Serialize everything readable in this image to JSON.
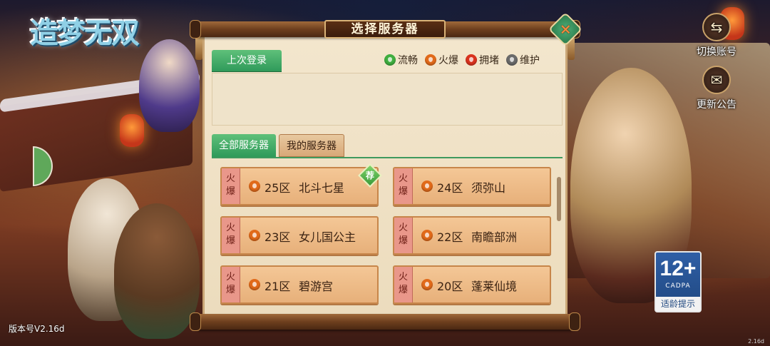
{
  "game": {
    "logo_text": "造梦无双"
  },
  "side_buttons": {
    "switch_account": "切换账号",
    "notice": "更新公告"
  },
  "dialog": {
    "title": "选择服务器",
    "last_login_tab": "上次登录",
    "legend": [
      {
        "label": "流畅",
        "color": "#3fae3f"
      },
      {
        "label": "火爆",
        "color": "#e16a1a"
      },
      {
        "label": "拥堵",
        "color": "#d9321e"
      },
      {
        "label": "维护",
        "color": "#6a6a6a"
      }
    ],
    "tabs": {
      "all": "全部服务器",
      "mine": "我的服务器"
    },
    "servers": [
      {
        "state_line1": "火",
        "state_line2": "爆",
        "zone": "25区",
        "name": "北斗七星",
        "badge": "荐"
      },
      {
        "state_line1": "火",
        "state_line2": "爆",
        "zone": "24区",
        "name": "须弥山"
      },
      {
        "state_line1": "火",
        "state_line2": "爆",
        "zone": "23区",
        "name": "女儿国公主"
      },
      {
        "state_line1": "火",
        "state_line2": "爆",
        "zone": "22区",
        "name": "南瞻部洲"
      },
      {
        "state_line1": "火",
        "state_line2": "爆",
        "zone": "21区",
        "name": "碧游宫"
      },
      {
        "state_line1": "火",
        "state_line2": "爆",
        "zone": "20区",
        "name": "蓬莱仙境"
      }
    ]
  },
  "age_rating": {
    "number": "12+",
    "org": "CADPA",
    "label": "适龄提示"
  },
  "version": "版本号V2.16d",
  "corner_version": "2.16d"
}
